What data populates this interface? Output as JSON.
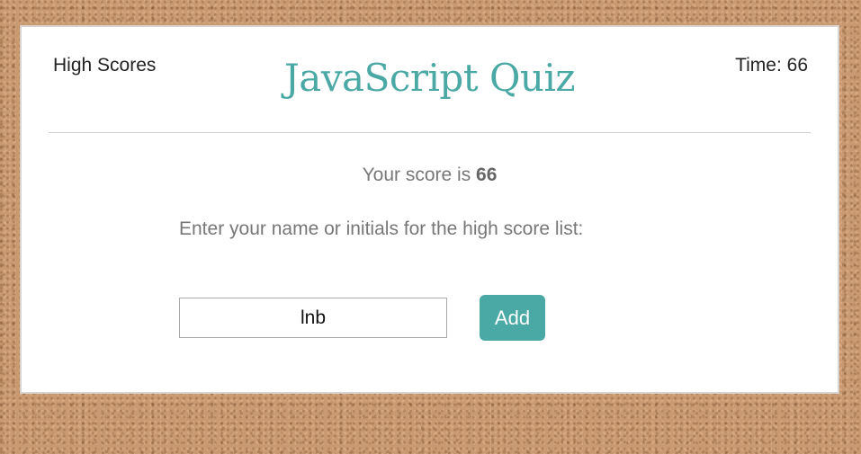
{
  "header": {
    "high_scores_label": "High Scores",
    "title": "JavaScript Quiz",
    "timer_label": "Time: 66"
  },
  "result": {
    "score_prefix": "Your score is ",
    "score_value": "66",
    "prompt": "Enter your name or initials for the high score list:"
  },
  "form": {
    "name_value": "lnb",
    "add_label": "Add"
  },
  "colors": {
    "accent": "#4aa9a4",
    "card_background": "#ffffff",
    "page_background": "#c99a72"
  }
}
